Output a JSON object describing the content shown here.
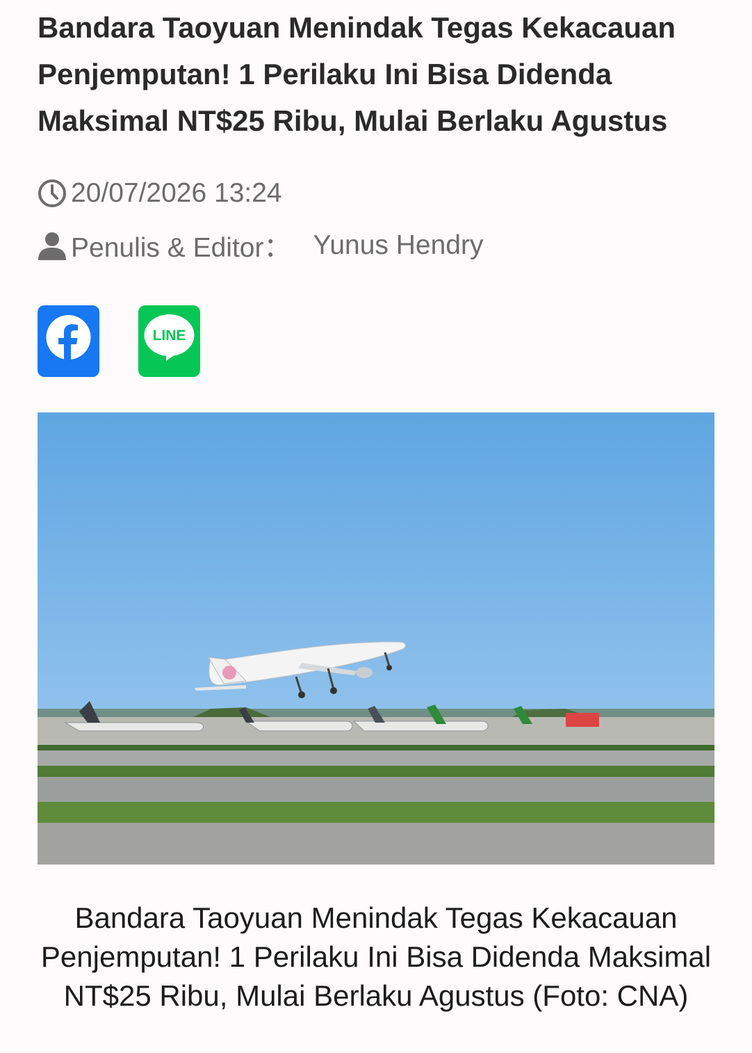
{
  "article": {
    "title": "Bandara Taoyuan Menindak Tegas Kekacauan Penjemputan! 1 Perilaku Ini Bisa Didenda Maksimal NT$25 Ribu, Mulai Berlaku Agustus",
    "datetime": "20/07/2026 13:24",
    "author_label": "Penulis & Editor：",
    "author_name": "Yunus Hendry"
  },
  "share": {
    "facebook_icon": "facebook-icon",
    "line_icon": "line-icon",
    "line_text": "LINE",
    "facebook_color": "#1877f2",
    "line_color": "#06c755"
  },
  "photo": {
    "caption": "Bandara Taoyuan Menindak Tegas Kekacauan Penjemputan! 1 Perilaku Ini Bisa Didenda Maksimal NT$25 Ribu, Mulai Berlaku Agustus (Foto: CNA)"
  },
  "icons": {
    "clock": "clock-icon",
    "person": "person-icon"
  }
}
